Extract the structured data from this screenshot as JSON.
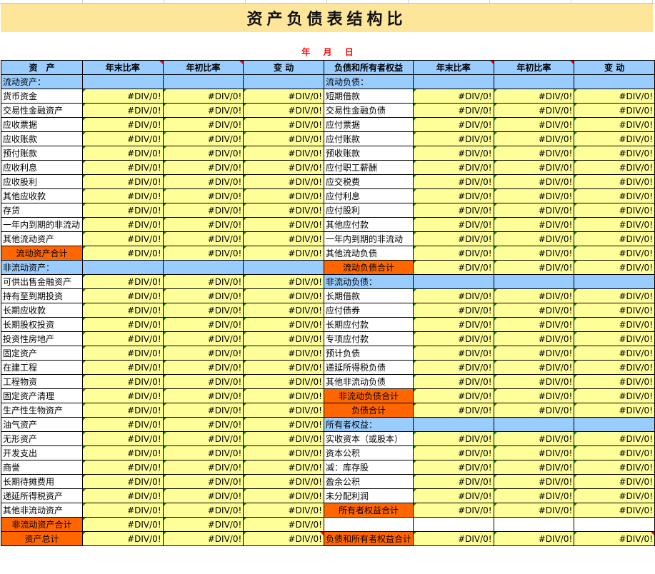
{
  "title": "资产负债表结构比",
  "date": {
    "year": "年",
    "month": "月",
    "day": "日"
  },
  "headers": [
    "资　产",
    "年末比率",
    "年初比率",
    "变  动",
    "负债和所有者权益",
    "年末比率",
    "年初比率",
    "变  动"
  ],
  "error_value": "#DIV/0!",
  "colors": {
    "title_bg": "#fde59a",
    "header_bg": "#99ccff",
    "value_bg": "#ffff99",
    "total_bg": "#ff6600",
    "date_color": "#ff0000"
  },
  "rows": [
    {
      "left": {
        "label": "流动资产：",
        "type": "section"
      },
      "right": {
        "label": "流动负债：",
        "type": "section"
      }
    },
    {
      "left": {
        "label": "货币资金",
        "type": "item"
      },
      "right": {
        "label": "短期借款",
        "type": "item"
      }
    },
    {
      "left": {
        "label": "交易性金融资产",
        "type": "item"
      },
      "right": {
        "label": "交易性金融负债",
        "type": "item"
      }
    },
    {
      "left": {
        "label": "应收票据",
        "type": "item"
      },
      "right": {
        "label": "应付票据",
        "type": "item"
      }
    },
    {
      "left": {
        "label": "应收账款",
        "type": "item"
      },
      "right": {
        "label": "应付账款",
        "type": "item"
      }
    },
    {
      "left": {
        "label": "预付账款",
        "type": "item"
      },
      "right": {
        "label": "预收账款",
        "type": "item"
      }
    },
    {
      "left": {
        "label": "应收利息",
        "type": "item"
      },
      "right": {
        "label": "应付职工薪酬",
        "type": "item"
      }
    },
    {
      "left": {
        "label": "应收股利",
        "type": "item"
      },
      "right": {
        "label": "应交税费",
        "type": "item"
      }
    },
    {
      "left": {
        "label": "其他应收款",
        "type": "item"
      },
      "right": {
        "label": "应付利息",
        "type": "item"
      }
    },
    {
      "left": {
        "label": "存货",
        "type": "item"
      },
      "right": {
        "label": "应付股利",
        "type": "item"
      }
    },
    {
      "left": {
        "label": "一年内到期的非流动",
        "type": "item"
      },
      "right": {
        "label": "其他应付款",
        "type": "item"
      }
    },
    {
      "left": {
        "label": "其他流动资产",
        "type": "item"
      },
      "right": {
        "label": "一年内到期的非流动",
        "type": "item"
      }
    },
    {
      "left": {
        "label": "流动资产合计",
        "type": "total"
      },
      "right": {
        "label": "其他流动负债",
        "type": "item"
      }
    },
    {
      "left": {
        "label": "非流动资产：",
        "type": "section"
      },
      "right": {
        "label": "流动负债合计",
        "type": "total"
      }
    },
    {
      "left": {
        "label": "可供出售金融资产",
        "type": "item"
      },
      "right": {
        "label": "非流动负债：",
        "type": "section"
      }
    },
    {
      "left": {
        "label": "持有至到期投资",
        "type": "item"
      },
      "right": {
        "label": "长期借款",
        "type": "item"
      }
    },
    {
      "left": {
        "label": "长期应收款",
        "type": "item"
      },
      "right": {
        "label": "应付债券",
        "type": "item"
      }
    },
    {
      "left": {
        "label": "长期股权投资",
        "type": "item"
      },
      "right": {
        "label": "长期应付款",
        "type": "item"
      }
    },
    {
      "left": {
        "label": "投资性房地产",
        "type": "item"
      },
      "right": {
        "label": "专项应付款",
        "type": "item"
      }
    },
    {
      "left": {
        "label": "固定资产",
        "type": "item"
      },
      "right": {
        "label": "预计负债",
        "type": "item"
      }
    },
    {
      "left": {
        "label": "在建工程",
        "type": "item"
      },
      "right": {
        "label": "递延所得税负债",
        "type": "item"
      }
    },
    {
      "left": {
        "label": "工程物资",
        "type": "item"
      },
      "right": {
        "label": "其他非流动负债",
        "type": "item"
      }
    },
    {
      "left": {
        "label": "固定资产清理",
        "type": "item"
      },
      "right": {
        "label": "非流动负债合计",
        "type": "total"
      }
    },
    {
      "left": {
        "label": "生产性生物资产",
        "type": "item"
      },
      "right": {
        "label": "负债合计",
        "type": "total"
      }
    },
    {
      "left": {
        "label": "油气资产",
        "type": "item"
      },
      "right": {
        "label": "所有者权益：",
        "type": "section"
      }
    },
    {
      "left": {
        "label": "无形资产",
        "type": "item"
      },
      "right": {
        "label": "实收资本（或股本）",
        "type": "item"
      }
    },
    {
      "left": {
        "label": "开发支出",
        "type": "item"
      },
      "right": {
        "label": "资本公积",
        "type": "item"
      }
    },
    {
      "left": {
        "label": "商誉",
        "type": "item"
      },
      "right": {
        "label": "减：库存股",
        "type": "item"
      }
    },
    {
      "left": {
        "label": "长期待摊费用",
        "type": "item"
      },
      "right": {
        "label": "盈余公积",
        "type": "item"
      }
    },
    {
      "left": {
        "label": "递延所得税资产",
        "type": "item"
      },
      "right": {
        "label": "未分配利润",
        "type": "item"
      }
    },
    {
      "left": {
        "label": "其他非流动资产",
        "type": "item"
      },
      "right": {
        "label": "所有者权益合计",
        "type": "total"
      }
    },
    {
      "left": {
        "label": "非流动资产合计",
        "type": "total"
      },
      "right": {
        "label": "",
        "type": "blank"
      }
    },
    {
      "left": {
        "label": "资产总计",
        "type": "total"
      },
      "right": {
        "label": "负债和所有者权益合计",
        "type": "total"
      }
    }
  ]
}
